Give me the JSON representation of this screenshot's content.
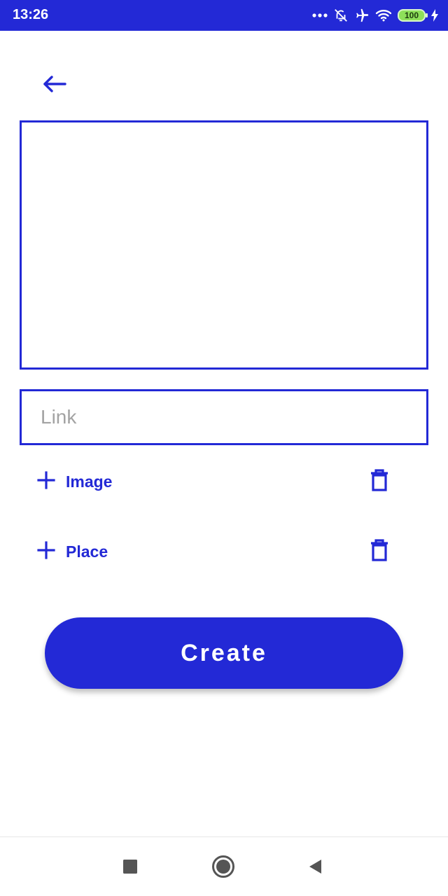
{
  "status_bar": {
    "time": "13:26",
    "battery": "100",
    "background": "#2329d6",
    "icons": [
      "more-dots-icon",
      "bell-off-icon",
      "airplane-icon",
      "wifi-icon",
      "battery-icon",
      "charging-icon"
    ]
  },
  "header": {
    "back_icon": "arrow-left-icon"
  },
  "form": {
    "link": {
      "value": "",
      "placeholder": "Link"
    },
    "options": [
      {
        "label": "Image",
        "add_icon": "plus-icon",
        "delete_icon": "trash-icon"
      },
      {
        "label": "Place",
        "add_icon": "plus-icon",
        "delete_icon": "trash-icon"
      }
    ],
    "create_label": "Create"
  },
  "colors": {
    "accent": "#2329d6",
    "placeholder": "#a3a3a3"
  },
  "nav_bar": {
    "icons": [
      "recents-square-icon",
      "home-circle-icon",
      "back-triangle-icon"
    ]
  }
}
